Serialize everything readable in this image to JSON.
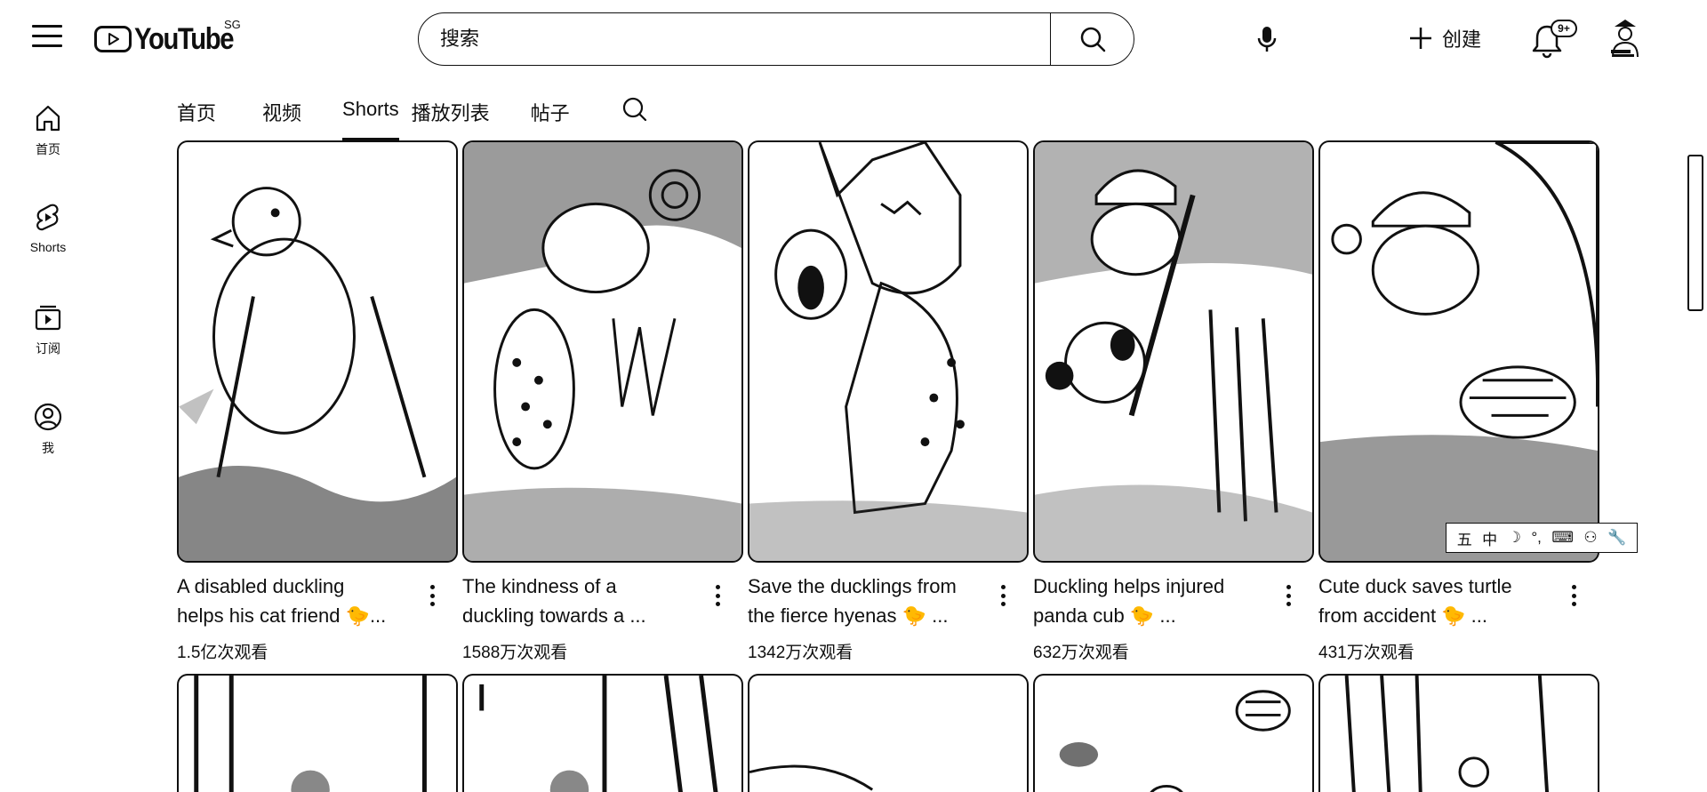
{
  "header": {
    "logo_text": "YouTube",
    "region": "SG",
    "search_placeholder": "搜索",
    "create_label": "创建",
    "notification_count": "9+"
  },
  "sidebar": {
    "items": [
      {
        "label": "首页",
        "icon": "home-icon"
      },
      {
        "label": "Shorts",
        "icon": "shorts-icon"
      },
      {
        "label": "订阅",
        "icon": "subscriptions-icon"
      },
      {
        "label": "我",
        "icon": "you-icon"
      }
    ]
  },
  "tabs": [
    {
      "label": "首页",
      "active": false
    },
    {
      "label": "视频",
      "active": false
    },
    {
      "label": "Shorts",
      "active": true
    },
    {
      "label": "播放列表",
      "active": false
    },
    {
      "label": "帖子",
      "active": false
    }
  ],
  "shorts": [
    {
      "title_line1": "A disabled duckling",
      "title_line2": "helps his cat friend 🐤...",
      "views": "1.5亿次观看"
    },
    {
      "title_line1": "The kindness of a",
      "title_line2": "duckling towards a ...",
      "views": "1588万次观看"
    },
    {
      "title_line1": "Save the ducklings from",
      "title_line2": "the fierce hyenas 🐤 ...",
      "views": "1342万次观看"
    },
    {
      "title_line1": "Duckling helps injured",
      "title_line2": "panda cub 🐤 ...",
      "views": "632万次观看"
    },
    {
      "title_line1": "Cute duck saves turtle",
      "title_line2": "from accident 🐤 ...",
      "views": "431万次观看"
    }
  ],
  "ime_toolbar": {
    "items": [
      "五",
      "中",
      "☽",
      "°,",
      "⌨",
      "⚇",
      "🔧"
    ]
  }
}
